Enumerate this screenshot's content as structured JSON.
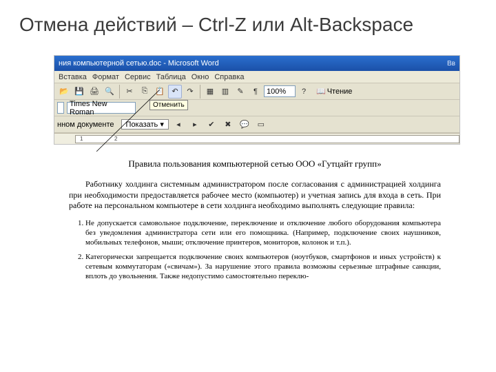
{
  "slide": {
    "title": "Отмена действий – Ctrl-Z или Alt-Backspace"
  },
  "word": {
    "titlebar": "ния компьютерной сетью.doc - Microsoft Word",
    "menu": {
      "insert": "Вставка",
      "format": "Формат",
      "tools": "Сервис",
      "table": "Таблица",
      "window": "Окно",
      "help": "Справка"
    },
    "tooltip": "Отменить",
    "zoom": "100%",
    "read": "Чтение",
    "font": "Times New Roman",
    "show": "Показать",
    "final_doc_label": "нном документе",
    "type_question": "Вв"
  },
  "doc": {
    "title": "Правила пользования компьютерной сетью ООО «Гутцайт групп»",
    "para1": "Работнику холдинга системным администратором после согласования с администрацией холдинга при необходимости предоставляется рабочее место (компьютер) и учетная запись для входа в сеть. При работе на персональном компьютере в сети холдинга необходимо выполнять следующие правила:",
    "item1": "Не допускается самовольное подключение, переключение и отключение любого оборудования компьютера без уведомления администратора сети или его помощника. (Например, подключение своих наушников, мобильных телефонов, мыши; отключение принтеров, мониторов, колонок и т.п.).",
    "item2": "Категорически запрещается подключение своих компьютеров (ноутбуков, смартфонов и иных устройств) к сетевым коммутаторам («свичам»). За нарушение этого правила возможны серьезные штрафные санкции, вплоть до увольнения. Также недопустимо самостоятельно переклю-"
  }
}
